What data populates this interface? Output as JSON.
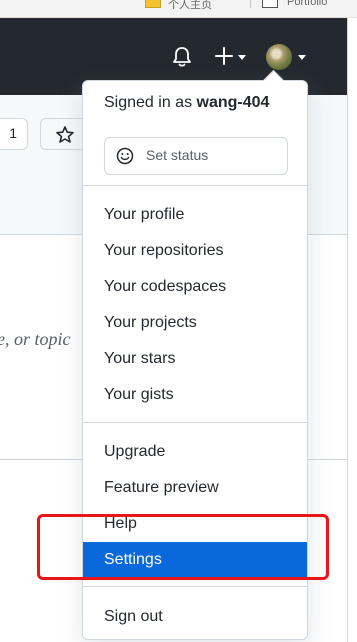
{
  "browser": {
    "bookmark_1_label": "个人主页",
    "bookmark_2_label": "Portfolio"
  },
  "header": {
    "bell_icon": "bell-icon",
    "plus_icon": "plus-icon",
    "avatar_icon": "avatar"
  },
  "page": {
    "count_value": "1",
    "star_icon": "star-icon",
    "search_hint": "e, or topic"
  },
  "menu": {
    "signed_in_prefix": "Signed in as ",
    "username": "wang-404",
    "set_status_label": "Set status",
    "items_group1": [
      {
        "label": "Your profile"
      },
      {
        "label": "Your repositories"
      },
      {
        "label": "Your codespaces"
      },
      {
        "label": "Your projects"
      },
      {
        "label": "Your stars"
      },
      {
        "label": "Your gists"
      }
    ],
    "items_group2": [
      {
        "label": "Upgrade"
      },
      {
        "label": "Feature preview"
      },
      {
        "label": "Help"
      },
      {
        "label": "Settings",
        "active": true
      }
    ],
    "sign_out_label": "Sign out"
  },
  "colors": {
    "header_bg": "#24292f",
    "active_item_bg": "#0969da",
    "highlight": "#e8151b"
  }
}
